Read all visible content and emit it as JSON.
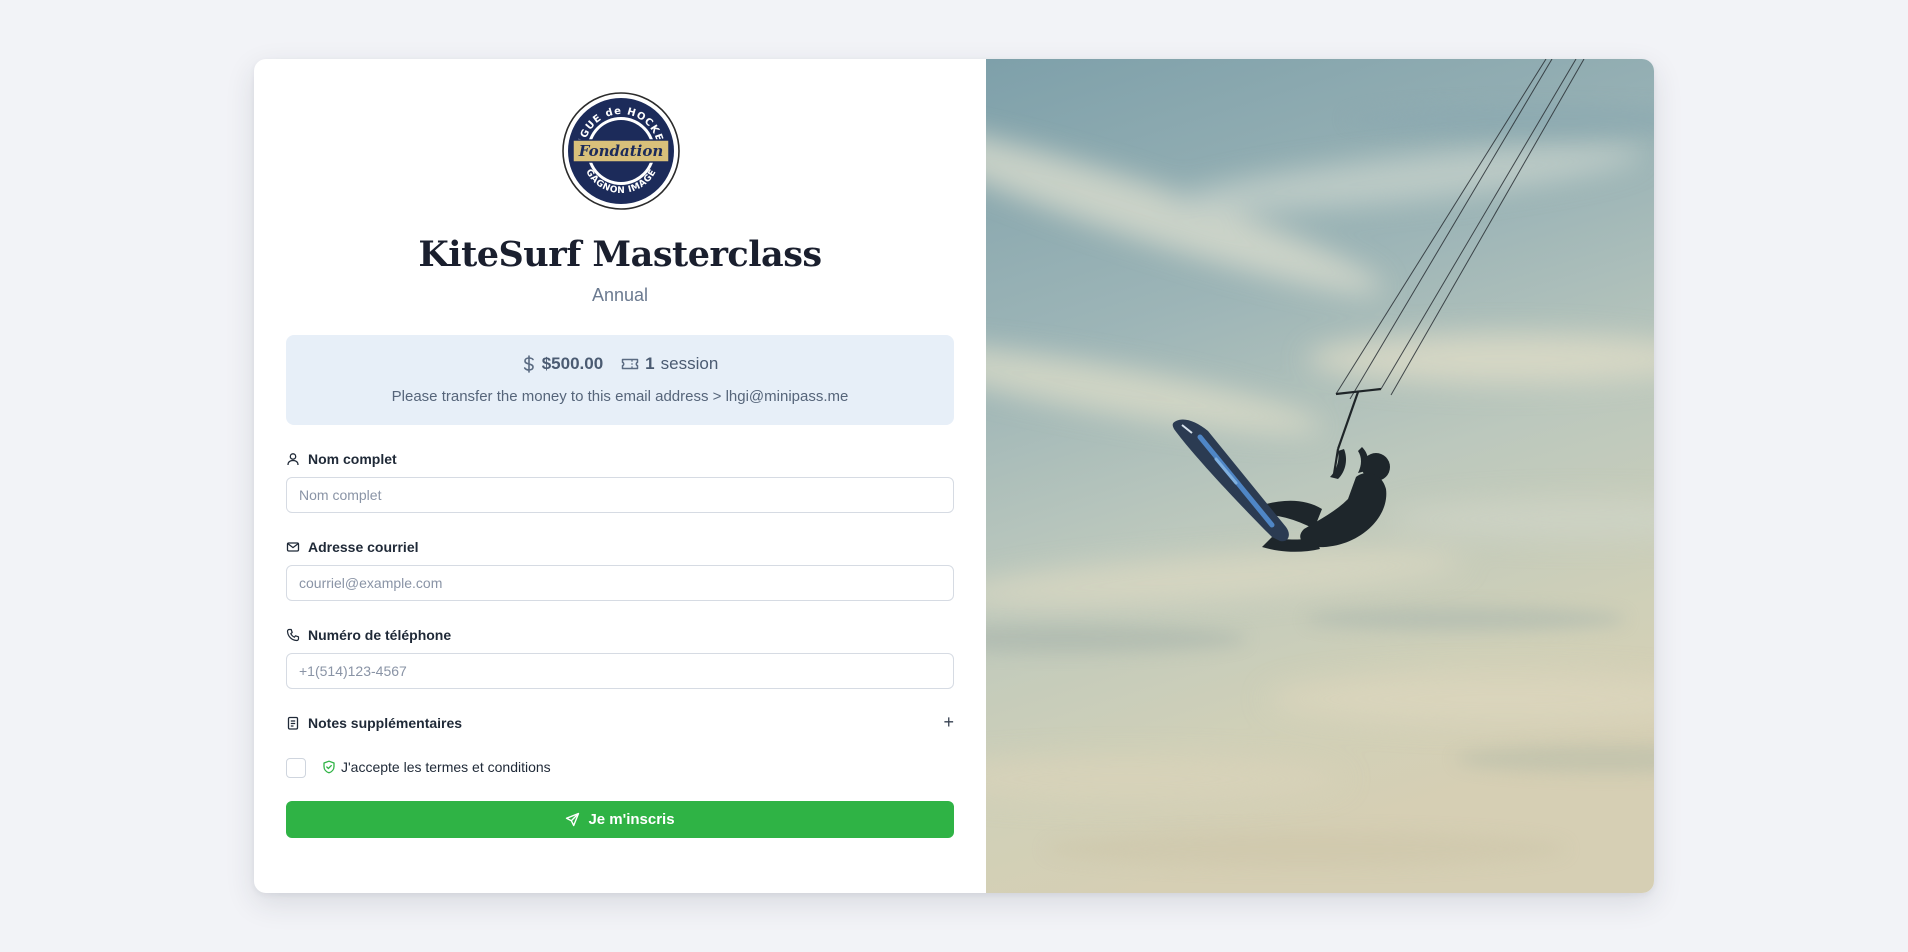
{
  "logo": {
    "top_text": "LIGUE de HOCKEY",
    "center_text": "Fondation",
    "bottom_text": "GAGNON IMAGE"
  },
  "event": {
    "title": "KiteSurf Masterclass",
    "subtitle": "Annual"
  },
  "info": {
    "price": "$500.00",
    "sessions_count": "1",
    "sessions_label": "session",
    "note": "Please transfer the money to this email address > lhgi@minipass.me"
  },
  "form": {
    "name_label": "Nom complet",
    "name_placeholder": "Nom complet",
    "email_label": "Adresse courriel",
    "email_placeholder": "courriel@example.com",
    "phone_label": "Numéro de téléphone",
    "phone_placeholder": "+1(514)123-4567",
    "notes_label": "Notes supplémentaires",
    "notes_toggle": "+",
    "terms_label": "J'accepte les termes et conditions",
    "submit_label": "Je m'inscris"
  },
  "colors": {
    "accent_green": "#2fb345",
    "info_bg": "#e7eff8",
    "logo_navy": "#1c2b5a",
    "logo_gold": "#d8c07a"
  },
  "icons": {
    "price": "dollar-icon",
    "sessions": "ticket-icon",
    "name": "user-icon",
    "email": "mail-icon",
    "phone": "phone-icon",
    "notes": "clipboard-icon",
    "terms": "shield-check-icon",
    "submit": "send-icon"
  }
}
